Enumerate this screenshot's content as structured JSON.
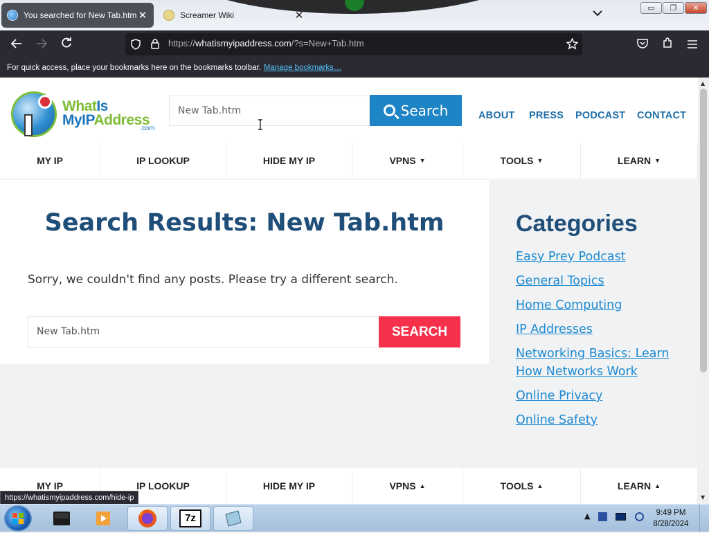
{
  "browser": {
    "tabs": [
      {
        "title": "You searched for New Tab.htm",
        "close": "✕"
      },
      {
        "title": "Screamer Wiki",
        "close": "✕"
      }
    ],
    "list_tabs_icon": "chevron-down-icon",
    "window_controls": {
      "minimize": "▭",
      "restore": "❐",
      "close": "✕"
    },
    "url": {
      "host_prefix": "https://",
      "host": "whatismyipaddress.com",
      "rest": "/?s=New+Tab.htm"
    },
    "bookmarks_bar": {
      "text": "For quick access, place your bookmarks here on the bookmarks toolbar.",
      "link": "Manage bookmarks…"
    },
    "status_url": "https://whatismyipaddress.com/hide-ip"
  },
  "site": {
    "logo": {
      "line1_a": "What",
      "line1_b": "Is",
      "line2_a": "MyIP",
      "line2_b": "Address",
      "suffix": ".com"
    },
    "header_search": {
      "value": "New Tab.htm",
      "button": "Search"
    },
    "top_links": [
      "ABOUT",
      "PRESS",
      "PODCAST",
      "CONTACT"
    ],
    "menu": [
      {
        "label": "MY IP",
        "arrow": ""
      },
      {
        "label": "IP LOOKUP",
        "arrow": ""
      },
      {
        "label": "HIDE MY IP",
        "arrow": ""
      },
      {
        "label": "VPNS",
        "arrow": "▼"
      },
      {
        "label": "TOOLS",
        "arrow": "▼"
      },
      {
        "label": "LEARN",
        "arrow": "▼"
      }
    ],
    "footer_menu": [
      {
        "label": "MY IP",
        "arrow": ""
      },
      {
        "label": "IP LOOKUP",
        "arrow": ""
      },
      {
        "label": "HIDE MY IP",
        "arrow": ""
      },
      {
        "label": "VPNS",
        "arrow": "▲"
      },
      {
        "label": "TOOLS",
        "arrow": "▲"
      },
      {
        "label": "LEARN",
        "arrow": "▲"
      }
    ],
    "results_title": "Search Results: New Tab.htm",
    "no_results": "Sorry, we couldn't find any posts. Please try a different search.",
    "content_search": {
      "value": "New Tab.htm",
      "button": "SEARCH"
    },
    "categories": {
      "title": "Categories",
      "items": [
        "Easy Prey Podcast",
        "General Topics",
        "Home Computing",
        "IP Addresses",
        "Networking Basics: Learn How Networks Work",
        "Online Privacy",
        "Online Safety"
      ]
    }
  },
  "taskbar": {
    "apps": [
      "media-center-icon",
      "media-player-icon",
      "firefox-icon",
      "7zip-icon",
      "notepad-icon"
    ],
    "seven_zip_label": "7z",
    "time": "9:49 PM",
    "date": "8/28/2024"
  },
  "colors": {
    "accent_blue": "#1d84c6",
    "search_red": "#f4304a",
    "heading_blue": "#1f4e79",
    "link_blue": "#1d8ad3"
  }
}
